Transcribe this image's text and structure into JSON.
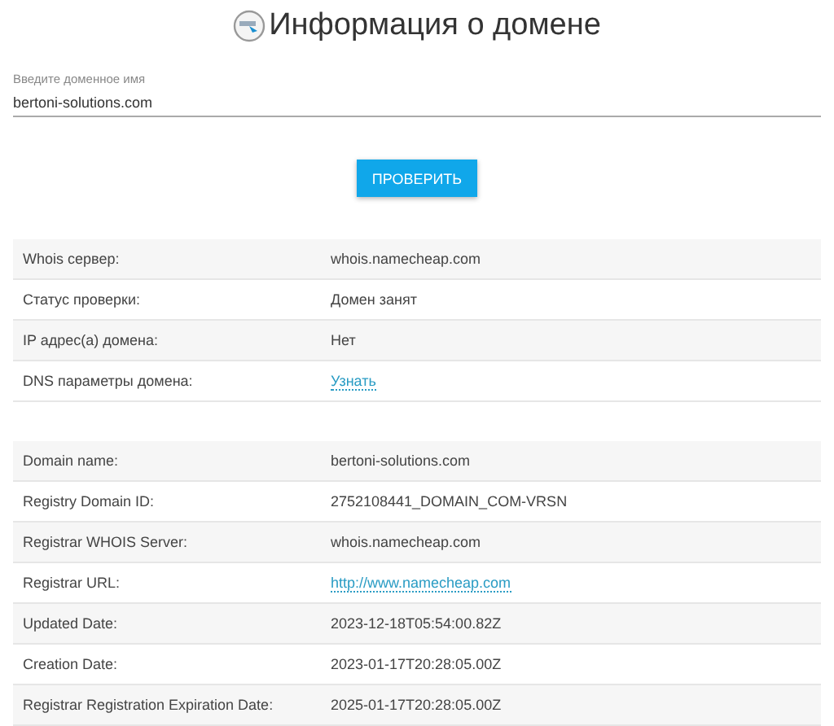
{
  "title": "Информация о домене",
  "domain_field": {
    "label": "Введите доменное имя",
    "value": "bertoni-solutions.com"
  },
  "check_button": "ПРОВЕРИТЬ",
  "summary": [
    {
      "label": "Whois сервер:",
      "value": "whois.namecheap.com",
      "kind": "text"
    },
    {
      "label": "Статус проверки:",
      "value": "Домен занят",
      "kind": "text"
    },
    {
      "label": "IP адрес(а) домена:",
      "value": "Нет",
      "kind": "text"
    },
    {
      "label": "DNS параметры домена:",
      "value": "Узнать",
      "kind": "link"
    }
  ],
  "whois": [
    {
      "label": "Domain name:",
      "value": "bertoni-solutions.com",
      "kind": "text"
    },
    {
      "label": "Registry Domain ID:",
      "value": "2752108441_DOMAIN_COM-VRSN",
      "kind": "text"
    },
    {
      "label": "Registrar WHOIS Server:",
      "value": "whois.namecheap.com",
      "kind": "text"
    },
    {
      "label": "Registrar URL:",
      "value": "http://www.namecheap.com",
      "kind": "link"
    },
    {
      "label": "Updated Date:",
      "value": "2023-12-18T05:54:00.82Z",
      "kind": "text"
    },
    {
      "label": "Creation Date:",
      "value": "2023-01-17T20:28:05.00Z",
      "kind": "text"
    },
    {
      "label": "Registrar Registration Expiration Date:",
      "value": "2025-01-17T20:28:05.00Z",
      "kind": "text"
    }
  ]
}
